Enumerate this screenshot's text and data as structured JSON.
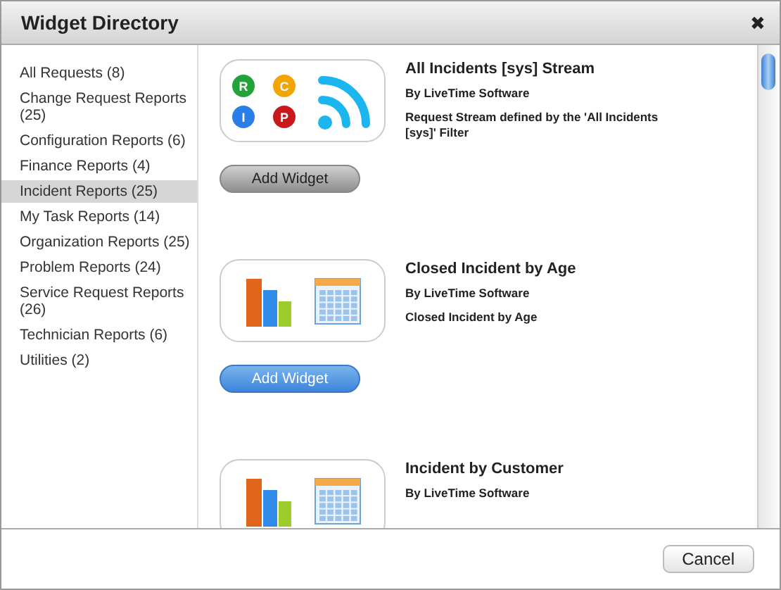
{
  "window": {
    "title": "Widget Directory",
    "close": "✖"
  },
  "sidebar": {
    "items": [
      {
        "label": "All Requests (8)",
        "selected": false
      },
      {
        "label": "Change Request Reports (25)",
        "selected": false
      },
      {
        "label": "Configuration Reports (6)",
        "selected": false
      },
      {
        "label": "Finance Reports (4)",
        "selected": false
      },
      {
        "label": "Incident Reports (25)",
        "selected": true
      },
      {
        "label": "My Task Reports (14)",
        "selected": false
      },
      {
        "label": "Organization Reports (25)",
        "selected": false
      },
      {
        "label": "Problem Reports (24)",
        "selected": false
      },
      {
        "label": "Service Request Reports (26)",
        "selected": false
      },
      {
        "label": "Technician Reports (6)",
        "selected": false
      },
      {
        "label": "Utilities (2)",
        "selected": false
      }
    ]
  },
  "widgets": [
    {
      "kind": "stream",
      "title": "All Incidents [sys] Stream",
      "author": "By LiveTime Software",
      "description": "Request Stream defined by the 'All Incidents [sys]' Filter",
      "badges": [
        "R",
        "C",
        "I",
        "P"
      ],
      "button": {
        "label": "Add Widget",
        "highlighted": false
      }
    },
    {
      "kind": "chart",
      "title": "Closed Incident by Age",
      "author": "By LiveTime Software",
      "description": "Closed Incident by Age",
      "button": {
        "label": "Add Widget",
        "highlighted": true
      }
    },
    {
      "kind": "chart",
      "title": "Incident by Customer",
      "author": "By LiveTime Software"
    }
  ],
  "footer": {
    "buttons": [
      "Cancel"
    ]
  }
}
